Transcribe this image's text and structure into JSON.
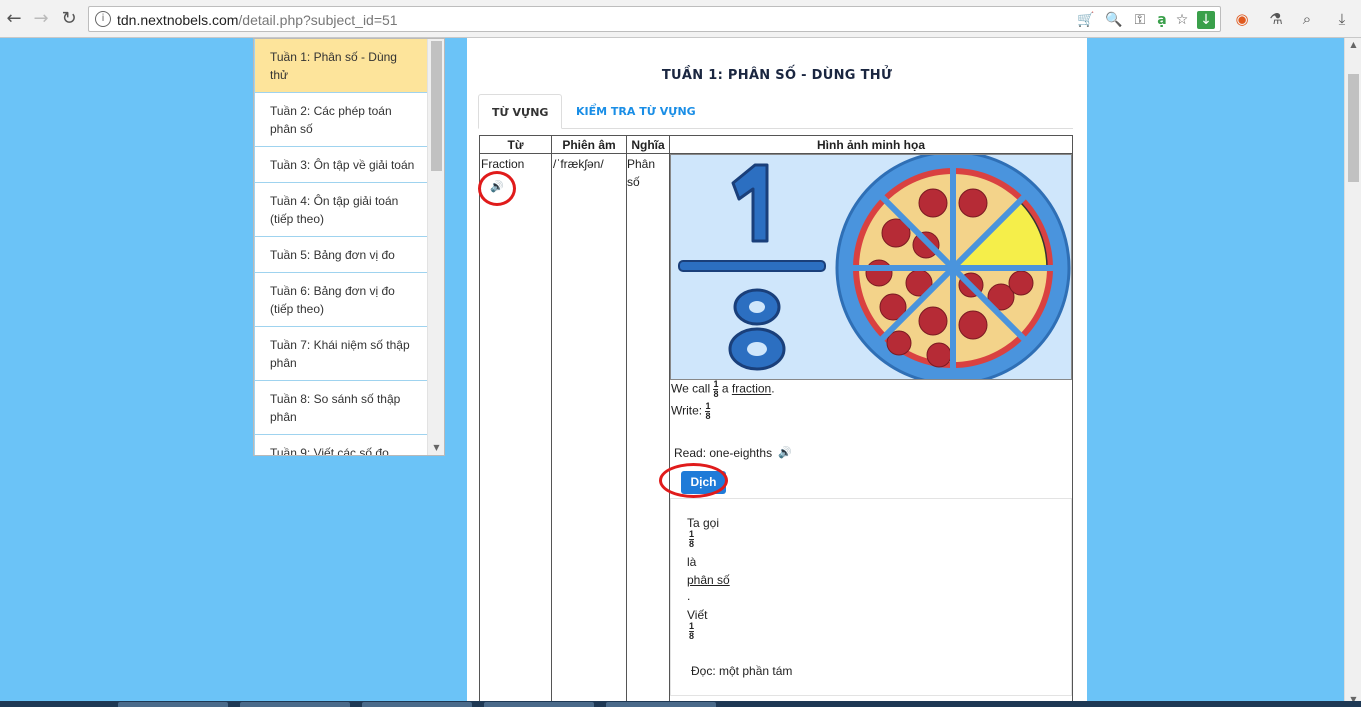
{
  "browser": {
    "url_host": "tdn.nextnobels.com",
    "url_path": "/detail.php?subject_id=51",
    "nav": {
      "back_icon": "←",
      "forward_icon": "→",
      "reload_icon": "↻",
      "menu_icon": "⋮"
    }
  },
  "sidebar": {
    "items": [
      {
        "label": "Tuần 1: Phân số - Dùng thử"
      },
      {
        "label": "Tuần 2: Các phép toán phân số"
      },
      {
        "label": "Tuần 3: Ôn tập về giải toán"
      },
      {
        "label": "Tuần 4: Ôn tập giải toán (tiếp theo)"
      },
      {
        "label": "Tuần 5: Bảng đơn vị đo"
      },
      {
        "label": "Tuần 6: Bảng đơn vị đo (tiếp theo)"
      },
      {
        "label": "Tuần 7: Khái niệm số thập phân"
      },
      {
        "label": "Tuần 8: So sánh số thập phân"
      },
      {
        "label": "Tuần 9: Viết các số đo"
      }
    ]
  },
  "main": {
    "title": "TUẦN 1: PHÂN SỐ - DÙNG THỬ",
    "tabs": [
      {
        "label": "TỪ VỰNG"
      },
      {
        "label": "KIỂM TRA TỪ VỰNG"
      }
    ],
    "table": {
      "headers": {
        "word": "Từ",
        "phonetic": "Phiên âm",
        "meaning": "Nghĩa",
        "image": "Hình ảnh minh họa"
      },
      "row": {
        "word": "Fraction",
        "phonetic": "/ˈfrækʃən/",
        "meaning_line1": "Phân",
        "meaning_line2": "số",
        "fraction_num": "1",
        "fraction_den": "8",
        "we_call": "We call",
        "a_word": "a",
        "fraction_word": "fraction",
        "period": ".",
        "write_label": "Write:",
        "read_label": "Read: one-eighths",
        "translate_button": "Dịch",
        "vi_ta_goi": "Ta gọi",
        "vi_la": "là",
        "vi_phan_so": "phân số",
        "vi_dot": ".",
        "vi_viet": "Viết",
        "vi_doc": "Đọc: một phần tám"
      }
    }
  },
  "colors": {
    "page_bg": "#6bc3f7",
    "active_item": "#fde49b",
    "tab_link": "#1a8ee6",
    "button": "#1f7bd8",
    "highlight_circle": "#e01b1b"
  }
}
